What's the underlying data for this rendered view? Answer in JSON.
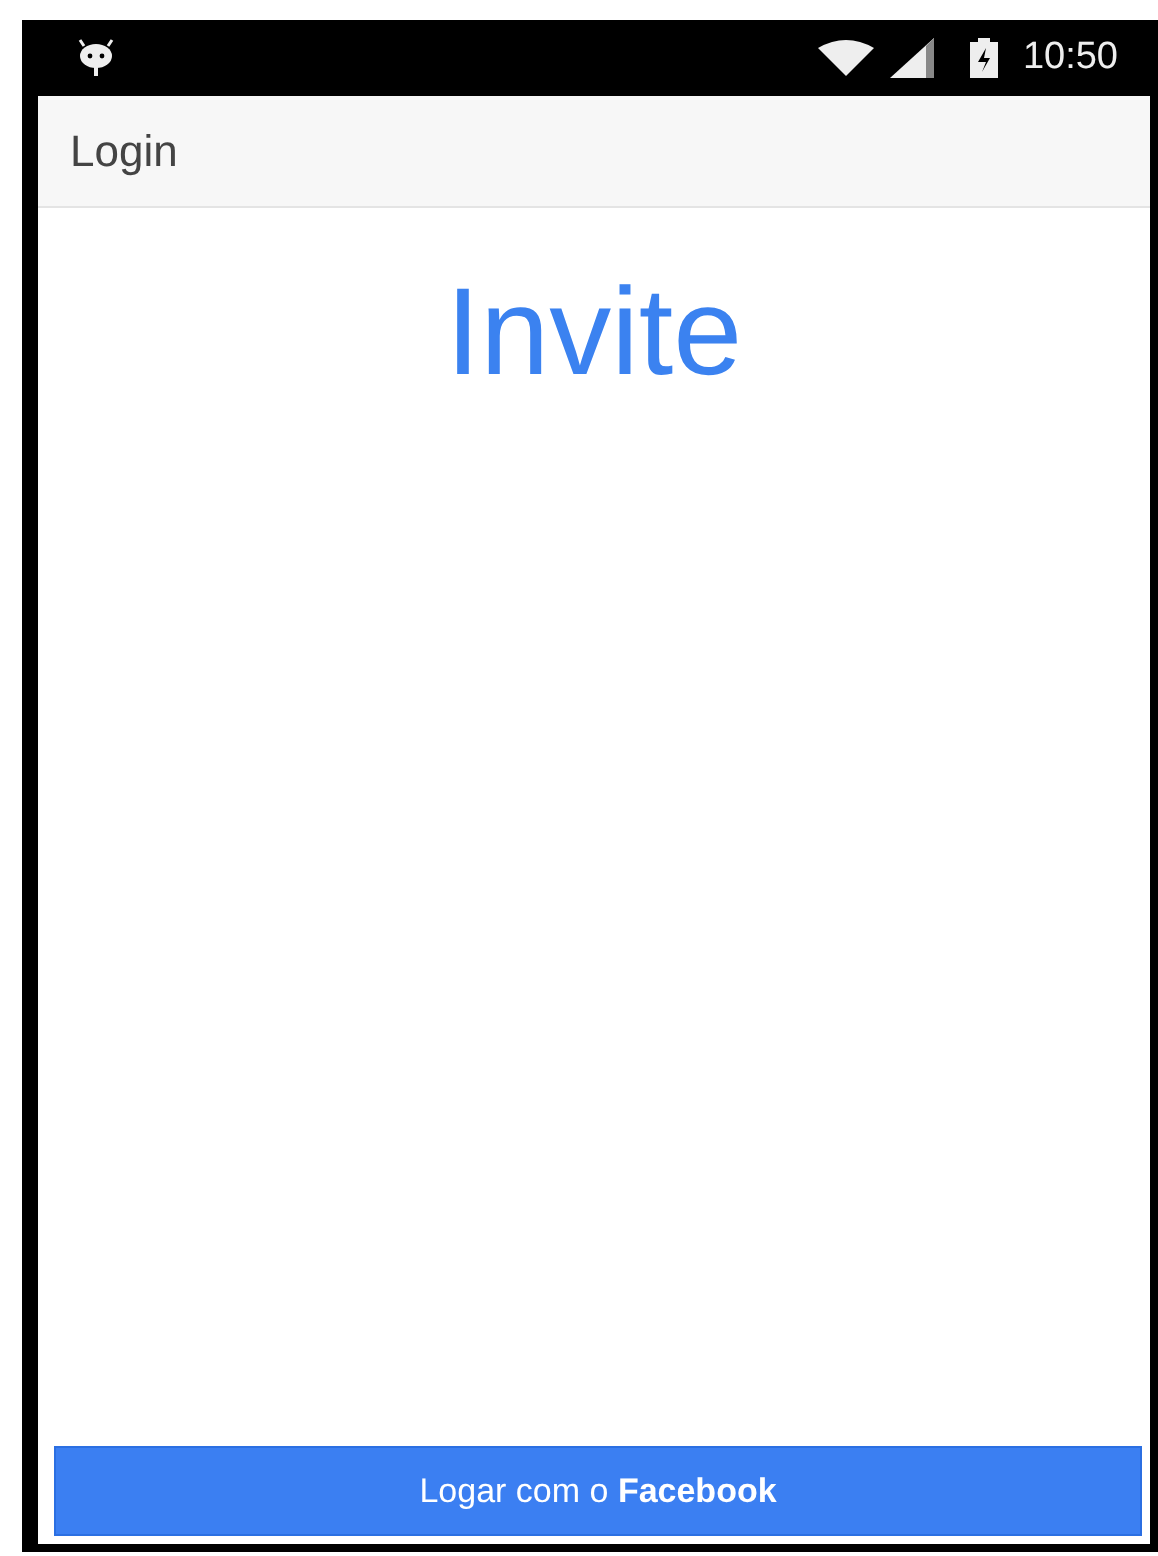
{
  "status_bar": {
    "time": "10:50"
  },
  "app_bar": {
    "title": "Login"
  },
  "heading": "Invite",
  "login_button": {
    "label": "Logar com o **Facebook**"
  }
}
